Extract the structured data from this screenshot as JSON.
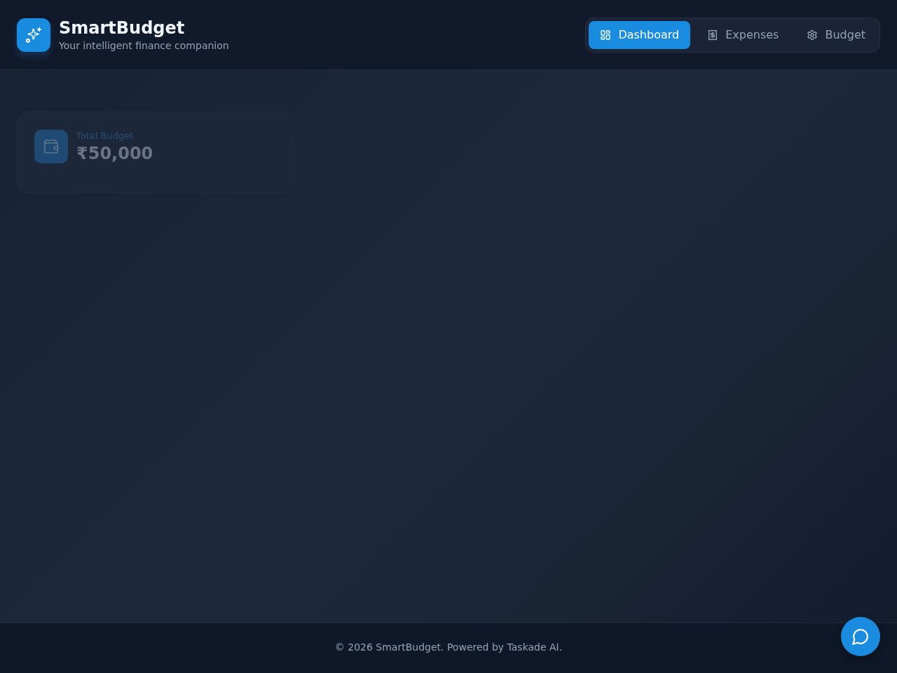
{
  "header": {
    "title": "SmartBudget",
    "subtitle": "Your intelligent finance companion"
  },
  "nav": [
    {
      "label": "Dashboard",
      "kind": "dashboard",
      "selected": true
    },
    {
      "label": "Expenses",
      "kind": "receipt",
      "selected": false
    },
    {
      "label": "Budget",
      "kind": "settings",
      "selected": false
    }
  ],
  "stats": [
    {
      "label": "Total Budget",
      "value": "₹50,000",
      "kind": "wallet"
    }
  ],
  "footer": {
    "text": "© 2026 SmartBudget. Powered by Taskade AI."
  }
}
